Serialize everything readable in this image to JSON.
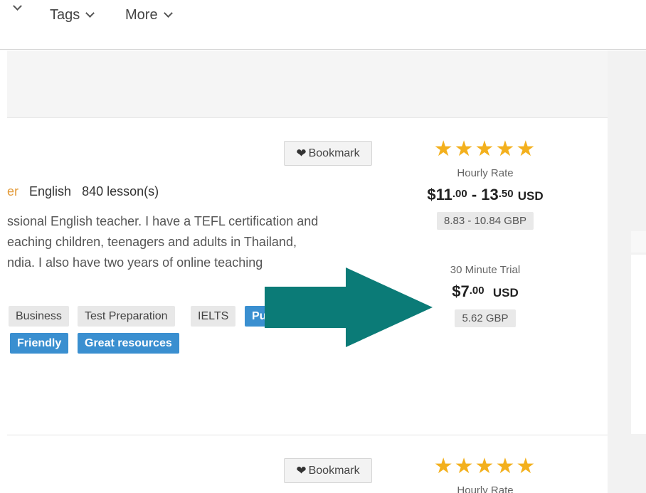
{
  "nav": {
    "items": [
      {
        "label": ""
      },
      {
        "label": "Tags"
      },
      {
        "label": "More"
      }
    ]
  },
  "card1": {
    "bookmark": "Bookmark",
    "meta": {
      "role_fragment": "er",
      "language": "English",
      "lessons": "840 lesson(s)"
    },
    "description": [
      "ssional English teacher. I have a TEFL certification and",
      "eaching children, teenagers and adults in Thailand,",
      "ndia. I also have two years of online teaching"
    ],
    "tags_row1": [
      "Business",
      "Test Preparation",
      "IELTS",
      "Pu"
    ],
    "tags_row2": [
      "Friendly",
      "Great resources"
    ],
    "rating_stars": 5,
    "hourly": {
      "label": "Hourly Rate",
      "low_whole": "$11",
      "low_cents": ".00",
      "sep": " - ",
      "high_whole": "13",
      "high_cents": ".50",
      "currency": "USD",
      "converted": "8.83 - 10.84 GBP"
    },
    "trial": {
      "label": "30 Minute Trial",
      "whole": "$7",
      "cents": ".00",
      "currency": "USD",
      "converted": "5.62 GBP"
    }
  },
  "card2": {
    "bookmark": "Bookmark",
    "rating_stars": 5,
    "hourly_label": "Hourly Rate"
  },
  "colors": {
    "accent_blue": "#3a8fd0",
    "star": "#f3b01d",
    "arrow": "#0b7b77"
  },
  "icons": [
    "chevron-down-icon",
    "heart-icon",
    "star-icon",
    "arrow-right-icon"
  ]
}
